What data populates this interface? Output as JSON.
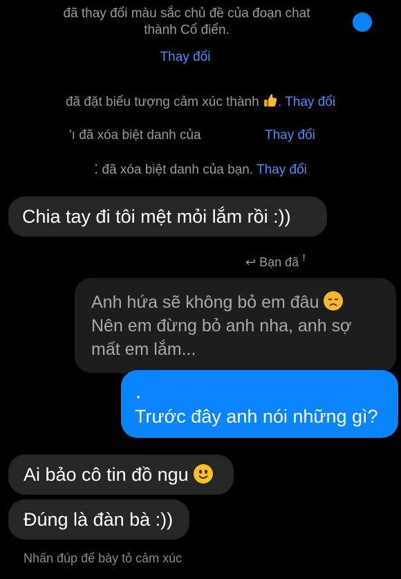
{
  "system": {
    "theme_line1": "đã thay đổi màu sắc chủ đề của đoạn chat",
    "theme_line2": "thành Cổ điển.",
    "change1": "Thay đổi",
    "emoji_text": "đã đặt biểu tượng cảm xúc thành",
    "emoji_change": ". Thay đổi",
    "nick1_prefix": "'ı",
    "nick1_text": "đã xóa biệt danh của",
    "nick1_change": "Thay đổi",
    "nick2_prefix": "⁚",
    "nick2_text": "đã xóa biệt danh của bạn.",
    "nick2_change": "Thay đổi"
  },
  "messages": {
    "m1": "Chia tay đi tôi mệt mỏi lắm rồi :))",
    "reply_indicator": "Bạn đã ꜝ",
    "quoted": [
      "Anh hứa sẽ không bỏ em đâu",
      "Nên em đừng bỏ anh nha, anh sợ",
      "mất em lắm..."
    ],
    "out": "Trước đây anh nói những gì?",
    "m2": "Ai bảo cô tin đồ ngu",
    "m3": "Đúng là đàn bà :))"
  },
  "footer": {
    "hint": "Nhấn đúp để bày tỏ cảm xúc"
  },
  "colors": {
    "background": "#000000",
    "accent": "#0a84ff",
    "link": "#4b8ef5"
  },
  "icons": [
    "reply-arrow-icon",
    "thumbs-up-icon",
    "sad-emoji-icon",
    "smile-emoji-icon",
    "status-dot-icon"
  ]
}
